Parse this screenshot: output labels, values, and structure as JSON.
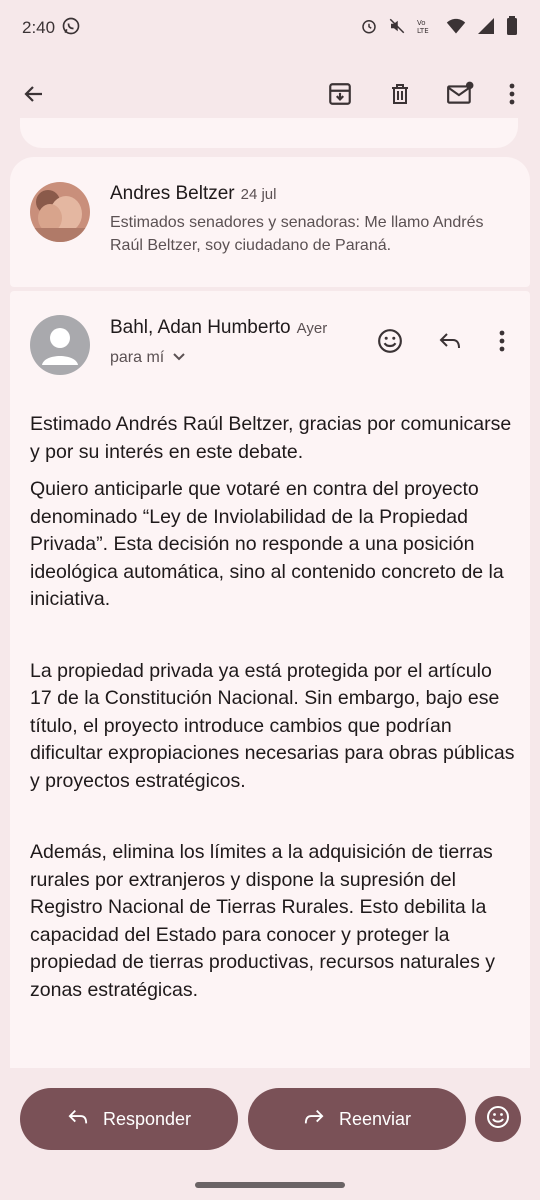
{
  "status": {
    "time": "2:40",
    "left_icons": [
      "whatsapp-icon"
    ],
    "right_icons": [
      "alarm-icon",
      "mute-icon",
      "volte-icon",
      "wifi-icon",
      "4g-signal-icon",
      "battery-icon"
    ]
  },
  "toolbar": {
    "icons": [
      "back-arrow-icon",
      "archive-icon",
      "trash-icon",
      "mark-unread-icon",
      "more-vert-icon"
    ]
  },
  "messages": [
    {
      "sender": "Andres Beltzer",
      "date": "24 jul",
      "snippet": "Estimados senadores y senadoras: Me llamo Andrés Raúl Beltzer, soy ciudadano de Paraná."
    },
    {
      "sender": "Bahl, Adan Humberto",
      "date": "Ayer",
      "to": "para mí",
      "actions": [
        "emoji-react-icon",
        "reply-icon",
        "more-vert-icon"
      ],
      "body": [
        "Estimado Andrés Raúl Beltzer, gracias por comunicarse y por su interés en este debate.",
        "Quiero anticiparle que votaré en contra del proyecto denominado “Ley de Inviolabilidad de la Propiedad Privada”. Esta decisión no responde a una posición ideológica automática, sino al contenido concreto de la iniciativa.",
        "La propiedad privada ya está protegida por el artículo 17 de la Constitución Nacional. Sin embargo, bajo ese título, el proyecto introduce cambios que podrían dificultar expropiaciones necesarias para obras públicas y proyectos estratégicos.",
        "Además, elimina los límites a la adquisición de tierras rurales por extranjeros y dispone la supresión del Registro Nacional de Tierras Rurales. Esto debilita la capacidad del Estado para conocer y proteger la propiedad de tierras productivas, recursos naturales y zonas estratégicas."
      ]
    }
  ],
  "bottom_actions": {
    "reply_label": "Responder",
    "forward_label": "Reenviar"
  },
  "colors": {
    "background": "#f6e8ea",
    "card": "#fdf4f5",
    "accent": "#7a5157"
  }
}
